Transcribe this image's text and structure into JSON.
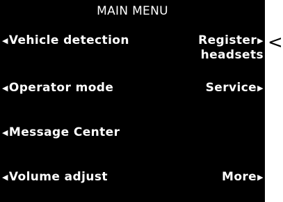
{
  "screen": {
    "title": "MAIN MENU",
    "arrow_left": "◀",
    "arrow_right": "▶",
    "left_items": [
      {
        "label": "Vehicle detection"
      },
      {
        "label": "Operator mode"
      },
      {
        "label": "Message Center"
      },
      {
        "label": "Volume adjust"
      }
    ],
    "right_items": [
      {
        "line1": "Register",
        "line2": "headsets"
      },
      {
        "line1": "Service"
      },
      {
        "line1": "More"
      }
    ]
  },
  "callout": {
    "pointer": "<"
  }
}
